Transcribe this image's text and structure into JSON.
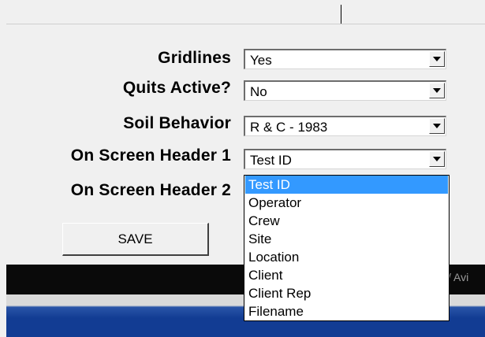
{
  "form": {
    "fields": [
      {
        "label": "Gridlines",
        "value": "Yes"
      },
      {
        "label": "Quits Active?",
        "value": "No"
      },
      {
        "label": "Soil Behavior",
        "value": "R & C - 1983"
      },
      {
        "label": "On Screen Header 1",
        "value": "Test ID"
      },
      {
        "label": "On Screen Header 2",
        "value": ""
      }
    ],
    "save_label": "SAVE"
  },
  "dropdown": {
    "selected": "Test ID",
    "options": [
      "Test ID",
      "Operator",
      "Crew",
      "Site",
      "Location",
      "Client",
      "Client Rep",
      "Filename"
    ]
  },
  "background": {
    "partial_text": "/ Avi"
  }
}
